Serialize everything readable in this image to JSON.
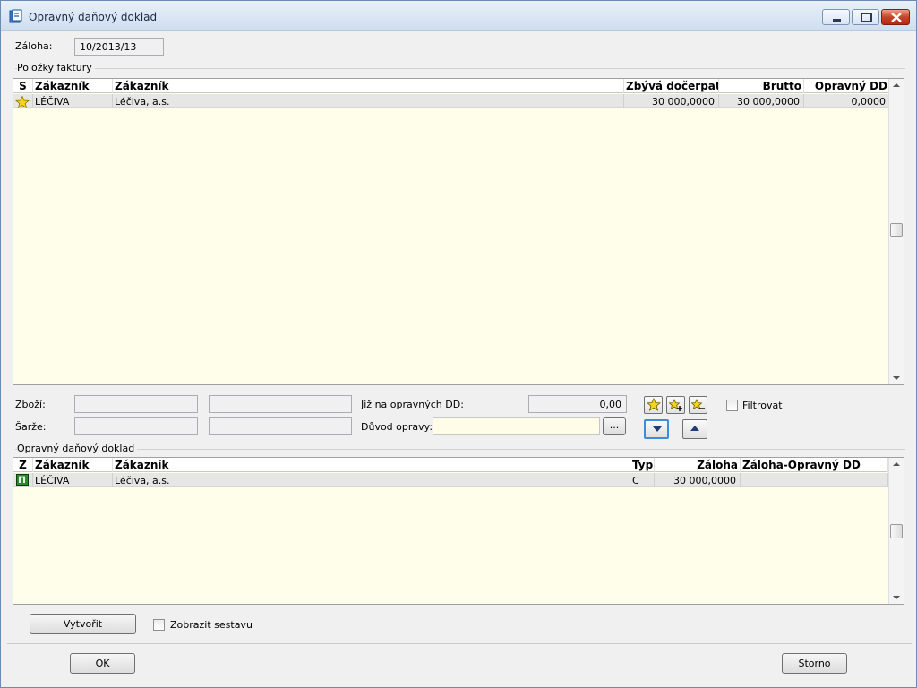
{
  "window": {
    "title": "Opravný daňový doklad"
  },
  "zaloha": {
    "label": "Záloha:",
    "value": "10/2013/13"
  },
  "polozky": {
    "group_title": "Položky faktury",
    "columns": [
      "S",
      "Zákazník",
      "Zákazník",
      "Zbývá dočerpat",
      "Brutto",
      "Opravný DD"
    ],
    "rows": [
      {
        "code": "LÉČIVA",
        "name": "Léčiva, a.s.",
        "zbyva": "30 000,0000",
        "brutto": "30 000,0000",
        "opravny": "0,0000"
      }
    ]
  },
  "form": {
    "zbozi_label": "Zboží:",
    "sarze_label": "Šarže:",
    "jiz_label": "Již na opravných DD:",
    "jiz_value": "0,00",
    "duvod_label": "Důvod opravy:",
    "ellipsis": "...",
    "filtrovat_label": "Filtrovat"
  },
  "opravny": {
    "group_title": "Opravný daňový doklad",
    "columns": [
      "Z",
      "Zákazník",
      "Zákazník",
      "Typ",
      "Záloha",
      "Záloha-Opravný DD"
    ],
    "rows": [
      {
        "code": "LÉČIVA",
        "name": "Léčiva, a.s.",
        "typ": "C",
        "zaloha": "30 000,0000",
        "rozdil": ""
      }
    ]
  },
  "actions": {
    "vytvorit": "Vytvořit",
    "zobrazit_label": "Zobrazit sestavu",
    "ok": "OK",
    "storno": "Storno"
  },
  "colors": {
    "grid_bg": "#fefeea",
    "title_bar": "#d8e5f4",
    "close_red": "#c8442b",
    "row_marker_green": "#2f8a2f",
    "star_yellow": "#f4d51a"
  }
}
